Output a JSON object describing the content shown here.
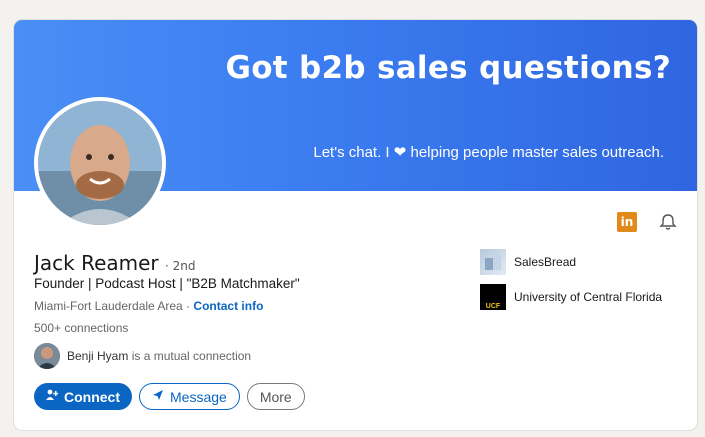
{
  "banner": {
    "headline": "Got b2b sales questions?",
    "subtext": "Let's chat. I ❤ helping people master sales outreach."
  },
  "profile": {
    "name": "Jack Reamer",
    "degree": "· 2nd",
    "headline": "Founder | Podcast Host | \"B2B Matchmaker\"",
    "location": "Miami-Fort Lauderdale Area",
    "location_sep": " · ",
    "contact_info": "Contact info",
    "connections": "500+ connections"
  },
  "mutual": {
    "name": "Benji Hyam",
    "text": " is a mutual connection"
  },
  "actions": {
    "connect": "Connect",
    "message": "Message",
    "more": "More"
  },
  "orgs": [
    {
      "name": "SalesBread"
    },
    {
      "name": "University of Central Florida",
      "logo_text": "UCF"
    }
  ],
  "icons": {
    "linkedin": "linkedin-icon",
    "bell": "bell-icon"
  },
  "colors": {
    "accent": "#0a66c2",
    "banner_start": "#4a8ef6",
    "banner_end": "#2f66e0",
    "linkedin_badge": "#e18a1a"
  }
}
